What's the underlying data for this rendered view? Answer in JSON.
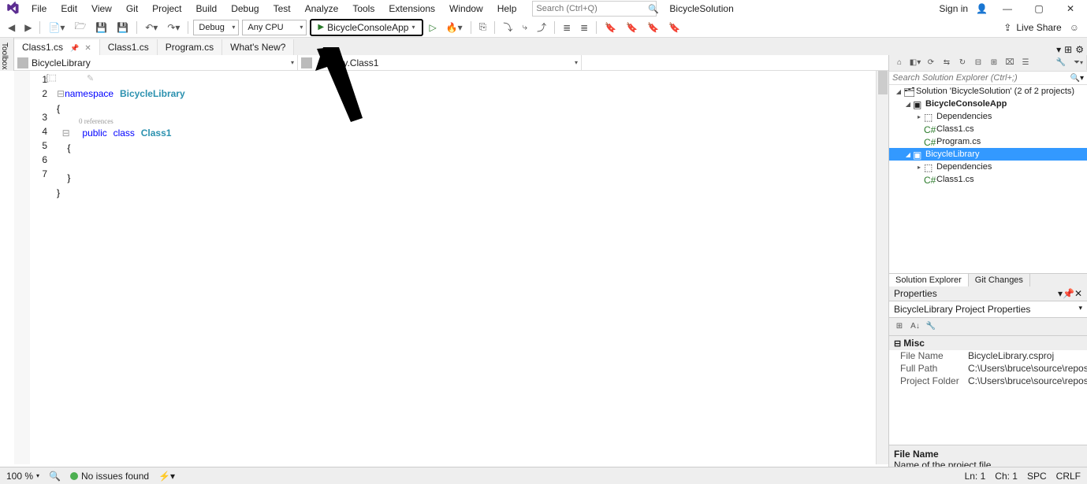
{
  "menu": {
    "items": [
      "File",
      "Edit",
      "View",
      "Git",
      "Project",
      "Build",
      "Debug",
      "Test",
      "Analyze",
      "Tools",
      "Extensions",
      "Window",
      "Help"
    ]
  },
  "search_placeholder": "Search (Ctrl+Q)",
  "solution_header": "BicycleSolution",
  "signin": "Sign in",
  "toolbar": {
    "config": "Debug",
    "platform": "Any CPU",
    "startup": "BicycleConsoleApp",
    "live_share": "Live Share"
  },
  "tabs": [
    {
      "label": "Class1.cs",
      "active": true,
      "pinned": true,
      "closable": true
    },
    {
      "label": "Class1.cs",
      "active": false
    },
    {
      "label": "Program.cs",
      "active": false
    },
    {
      "label": "What's New?",
      "active": false
    }
  ],
  "nav": {
    "project": "BicycleLibrary",
    "class": "brary.Class1"
  },
  "code": {
    "lines": [
      "1",
      "2",
      "3",
      "4",
      "5",
      "6",
      "7"
    ],
    "codelens": "0 references",
    "l1_kw": "namespace",
    "l1_nm": "BicycleLibrary",
    "l2": "{",
    "l3_pub": "public",
    "l3_cls": "class",
    "l3_nm": "Class1",
    "l4": "    {",
    "l5": "",
    "l6": "    }",
    "l7": "}"
  },
  "solution_explorer": {
    "title": "Solution Explorer",
    "search_placeholder": "Search Solution Explorer (Ctrl+;)",
    "root": "Solution 'BicycleSolution' (2 of 2 projects)",
    "p1": {
      "name": "BicycleConsoleApp",
      "deps": "Dependencies",
      "f1": "Class1.cs",
      "f2": "Program.cs"
    },
    "p2": {
      "name": "BicycleLibrary",
      "deps": "Dependencies",
      "f1": "Class1.cs"
    },
    "tabs": [
      "Solution Explorer",
      "Git Changes"
    ]
  },
  "properties": {
    "title": "Properties",
    "object": "BicycleLibrary Project Properties",
    "category": "Misc",
    "rows": [
      {
        "name": "File Name",
        "value": "BicycleLibrary.csproj"
      },
      {
        "name": "Full Path",
        "value": "C:\\Users\\bruce\\source\\repos\\Bicycle"
      },
      {
        "name": "Project Folder",
        "value": "C:\\Users\\bruce\\source\\repos\\Bicycle"
      }
    ],
    "desc_name": "File Name",
    "desc_text": "Name of the project file."
  },
  "status": {
    "zoom": "100 %",
    "issues": "No issues found",
    "ln": "Ln: 1",
    "ch": "Ch: 1",
    "spc": "SPC",
    "crlf": "CRLF"
  }
}
